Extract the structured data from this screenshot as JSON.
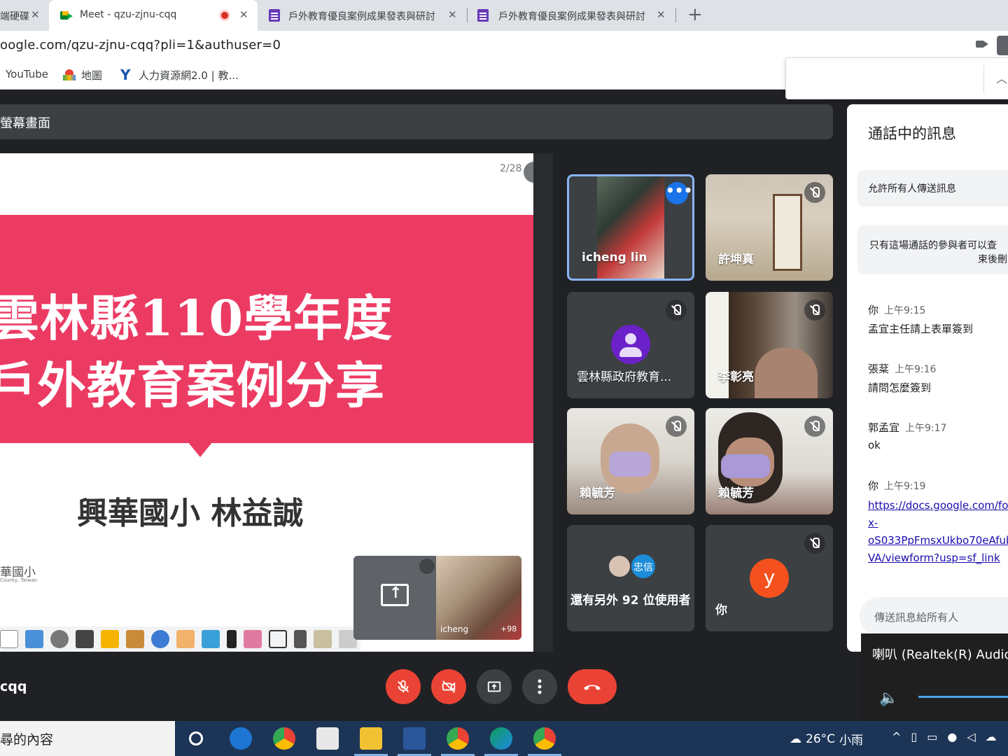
{
  "browser": {
    "tabs": [
      {
        "title": "端硬碟",
        "active": false
      },
      {
        "title": "Meet - qzu-zjnu-cqq",
        "active": true
      },
      {
        "title": "戶外教育優良案例成果發表與研討",
        "active": false
      },
      {
        "title": "戶外教育優良案例成果發表與研討",
        "active": false
      }
    ],
    "close_glyph": "✕",
    "new_tab_glyph": "+",
    "url": "oogle.com/qzu-zjnu-cqq?pli=1&authuser=0",
    "bookmarks": [
      {
        "label": "YouTube",
        "icon": "youtube-icon"
      },
      {
        "label": "地圖",
        "icon": "maps-icon"
      },
      {
        "label": "人力資源網2.0 | 教...",
        "icon": "hr-icon"
      }
    ]
  },
  "meet": {
    "presentation_bar": "螢幕畫面",
    "slide": {
      "page": "2/28",
      "title_line1": "雲林縣110學年度",
      "title_line2": "戶外教育案例分享",
      "author": "興華國小 林益誠",
      "school_logo_text": "華國小",
      "school_logo_sub": "County, Taiwan"
    },
    "self_preview": {
      "name": "icheng",
      "count": "+98"
    },
    "participants": [
      {
        "name": "icheng lin",
        "muted": false,
        "active": true
      },
      {
        "name": "許坤真",
        "muted": true
      },
      {
        "name": "雲林縣政府教育...",
        "muted": true,
        "avatar": "default"
      },
      {
        "name": "李彰亮",
        "muted": true
      },
      {
        "name": "賴毓芳",
        "muted": true
      },
      {
        "name": "賴毓芳",
        "muted": true
      }
    ],
    "others": {
      "label": "還有另外 92 位使用者",
      "chip": "忠信"
    },
    "you": {
      "label": "你",
      "avatar_letter": "y",
      "avatar_color": "#f4511e"
    },
    "meeting_code_fragment": "cqq",
    "controls": [
      {
        "name": "mic-toggle",
        "state": "off"
      },
      {
        "name": "camera-toggle",
        "state": "off"
      },
      {
        "name": "present-now"
      },
      {
        "name": "more-options"
      },
      {
        "name": "leave-call"
      }
    ],
    "chat": {
      "title": "通話中的訊息",
      "allow_all": "允許所有人傳送訊息",
      "notice_line1": "只有這場通話的參與者可以查",
      "notice_line2": "束後刪",
      "messages": [
        {
          "sender": "你",
          "time": "上午9:15",
          "text": "孟宜主任請上表單簽到"
        },
        {
          "sender": "張棻",
          "time": "上午9:16",
          "text": "請問怎麼簽到"
        },
        {
          "sender": "郭孟宜",
          "time": "上午9:17",
          "text": "ok"
        },
        {
          "sender": "你",
          "time": "上午9:19",
          "link_lines": [
            "https://docs.google.com/fo",
            "x-",
            "oS033PpFmsxUkbo70eAfub",
            "VA/viewform?usp=sf_link"
          ]
        }
      ],
      "input_placeholder": "傳送訊息給所有人"
    }
  },
  "system": {
    "volume_device": "喇叭 (Realtek(R) Audio)",
    "volume_level": 1.0,
    "taskbar_search": "尋的內容",
    "weather_temp": "26°C",
    "weather_desc": "小雨",
    "tray_caret": "^"
  },
  "colors": {
    "meet_bg": "#202124",
    "tile_bg": "#3c4043",
    "danger": "#ea4335",
    "slide_accent": "#ec3b63",
    "link": "#1a0dab",
    "taskbar": "#1c3557"
  }
}
